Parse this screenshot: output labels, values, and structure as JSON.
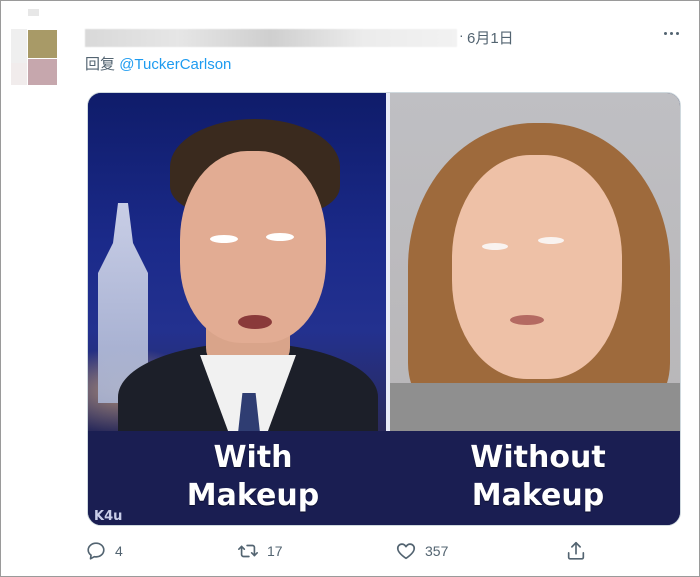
{
  "tweet": {
    "date": "6月1日",
    "separator": "·",
    "reply_prefix": "回复",
    "reply_handle": "@TuckerCarlson"
  },
  "media": {
    "caption_left": "With\nMakeup",
    "caption_right": "Without\nMakeup",
    "watermark": "K4u"
  },
  "actions": {
    "reply_count": "4",
    "retweet_count": "17",
    "like_count": "357"
  },
  "icons": {
    "more": "more-horizontal-icon",
    "reply": "reply-bubble-icon",
    "retweet": "retweet-icon",
    "like": "heart-icon",
    "share": "share-icon"
  },
  "colors": {
    "link": "#1d9bf0",
    "secondary_text": "#536471",
    "caption_background": "#1a1e52"
  }
}
